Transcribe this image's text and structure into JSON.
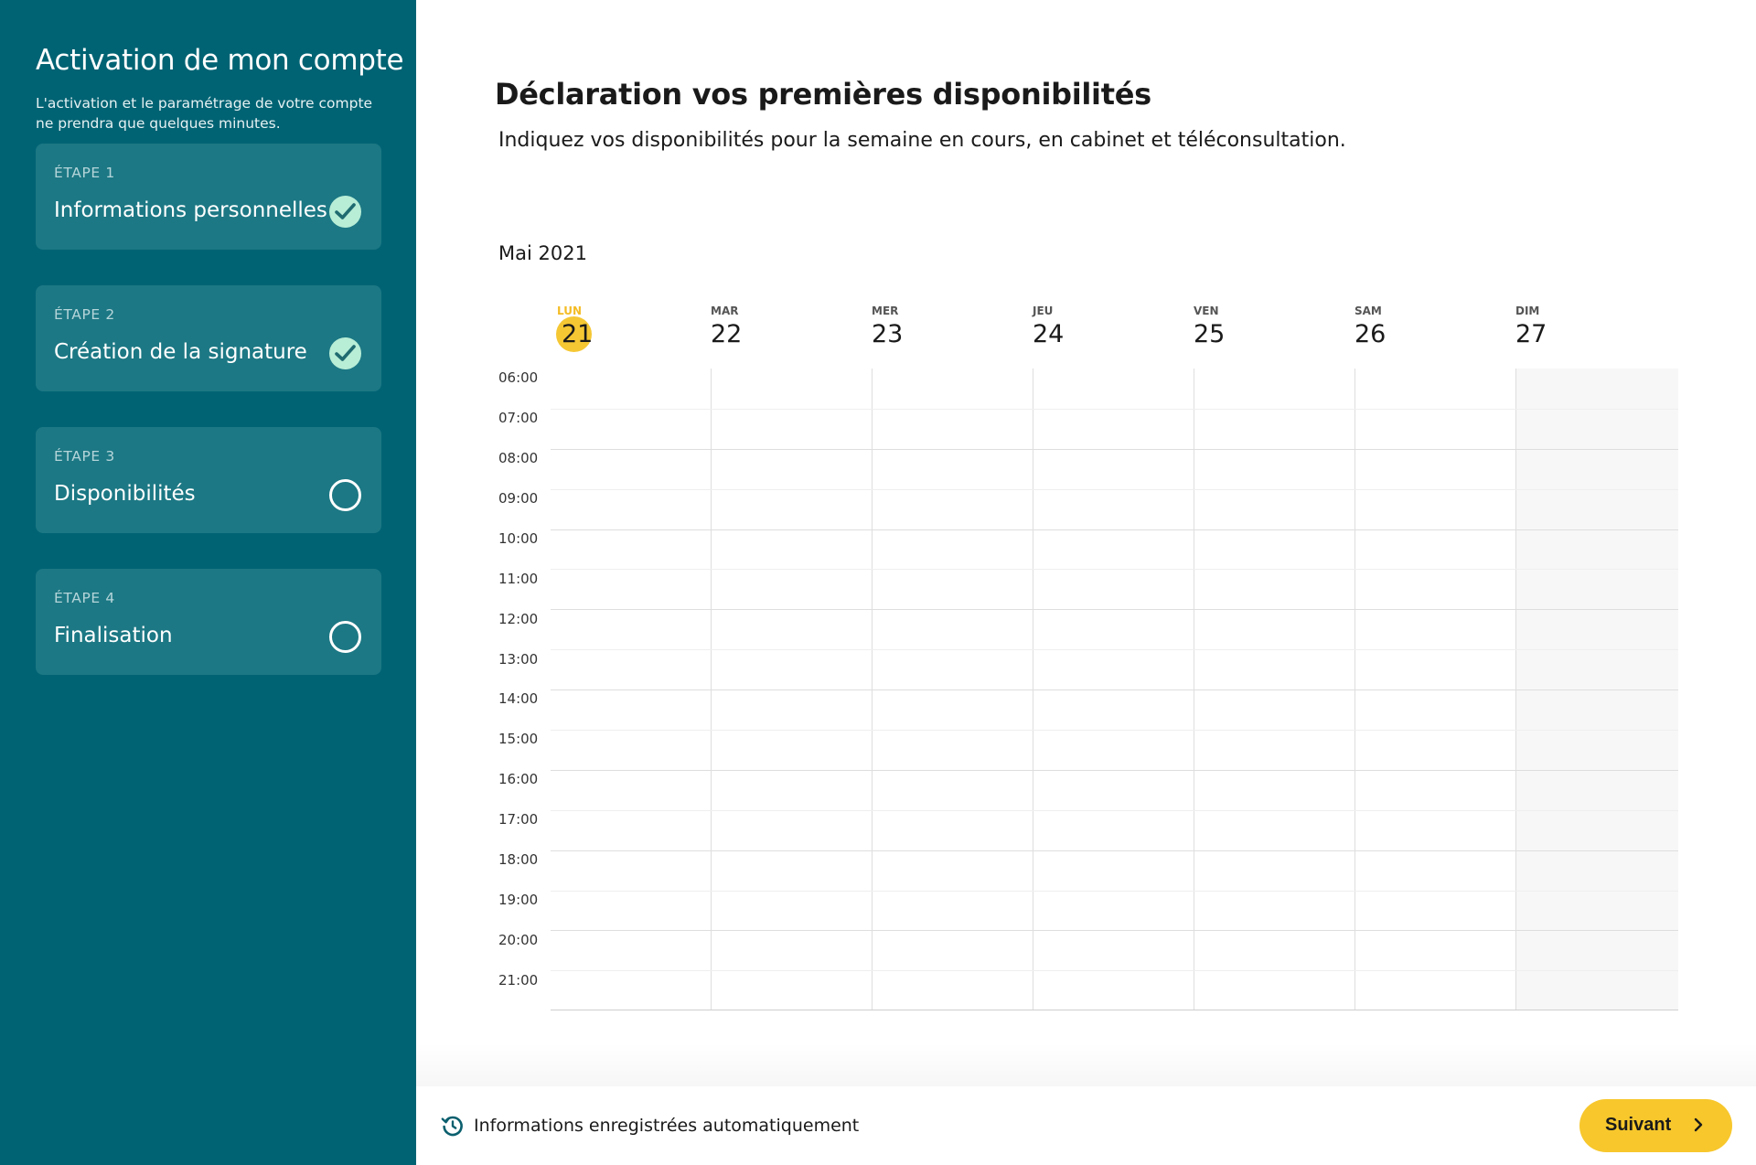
{
  "sidebar": {
    "title": "Activation de mon compte",
    "subtitle": "L'activation et le paramétrage de votre compte ne prendra que quelques minutes.",
    "steps": [
      {
        "number": "ÉTAPE 1",
        "label": "Informations personnelles",
        "status": "completed"
      },
      {
        "number": "ÉTAPE 2",
        "label": "Création de la signature",
        "status": "completed"
      },
      {
        "number": "ÉTAPE 3",
        "label": "Disponibilités",
        "status": "pending"
      },
      {
        "number": "ÉTAPE 4",
        "label": "Finalisation",
        "status": "pending"
      }
    ]
  },
  "main": {
    "title": "Déclaration vos premières disponibilités",
    "subtitle": "Indiquez vos disponibilités pour la semaine en cours, en cabinet et téléconsultation.",
    "month": "Mai 2021"
  },
  "calendar": {
    "days": [
      {
        "name": "LUN",
        "num": "21",
        "today": true
      },
      {
        "name": "MAR",
        "num": "22"
      },
      {
        "name": "MER",
        "num": "23"
      },
      {
        "name": "JEU",
        "num": "24"
      },
      {
        "name": "VEN",
        "num": "25"
      },
      {
        "name": "SAM",
        "num": "26"
      },
      {
        "name": "DIM",
        "num": "27"
      }
    ],
    "hours": [
      "06:00",
      "07:00",
      "08:00",
      "09:00",
      "10:00",
      "11:00",
      "12:00",
      "13:00",
      "14:00",
      "15:00",
      "16:00",
      "17:00",
      "18:00",
      "19:00",
      "20:00",
      "21:00"
    ]
  },
  "footer": {
    "autosave_text": "Informations enregistrées automatiquement",
    "next_label": "Suivant"
  },
  "colors": {
    "sidebar": "#006373",
    "step_card": "#1c7884",
    "check_bg": "#b8edd6",
    "accent_yellow": "#f7c72c"
  },
  "icons": {
    "completed": "check-circle-icon",
    "pending": "empty-circle-icon",
    "autosave": "history-icon",
    "next": "chevron-right-icon"
  }
}
